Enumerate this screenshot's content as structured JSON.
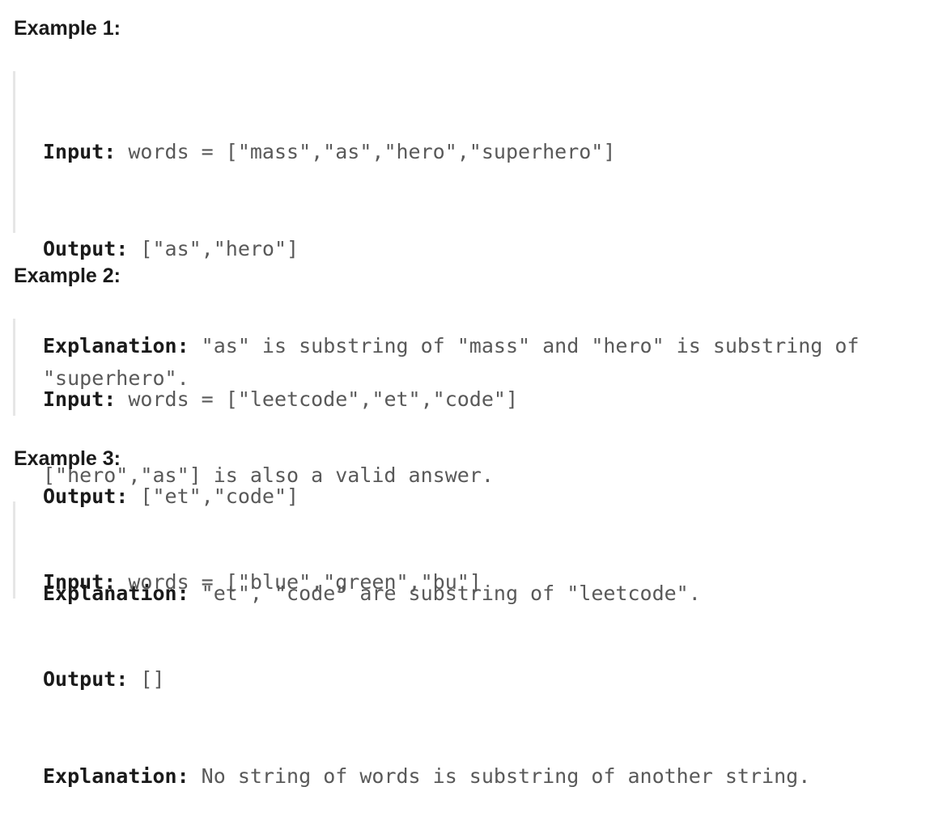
{
  "examples": [
    {
      "heading": "Example 1:",
      "input_label": "Input:",
      "input_value": " words = [\"mass\",\"as\",\"hero\",\"superhero\"]",
      "output_label": "Output:",
      "output_value": " [\"as\",\"hero\"]",
      "explanation_label": "Explanation:",
      "explanation_value": " \"as\" is substring of \"mass\" and \"hero\" is substring of \"superhero\".",
      "explanation_extra": "[\"hero\",\"as\"] is also a valid answer."
    },
    {
      "heading": "Example 2:",
      "input_label": "Input:",
      "input_value": " words = [\"leetcode\",\"et\",\"code\"]",
      "output_label": "Output:",
      "output_value": " [\"et\",\"code\"]",
      "explanation_label": "Explanation:",
      "explanation_value": " \"et\", \"code\" are substring of \"leetcode\"."
    },
    {
      "heading": "Example 3:",
      "input_label": "Input:",
      "input_value": " words = [\"blue\",\"green\",\"bu\"]",
      "output_label": "Output:",
      "output_value": " []",
      "explanation_label": "Explanation:",
      "explanation_value": " No string of words is substring of another string."
    }
  ]
}
